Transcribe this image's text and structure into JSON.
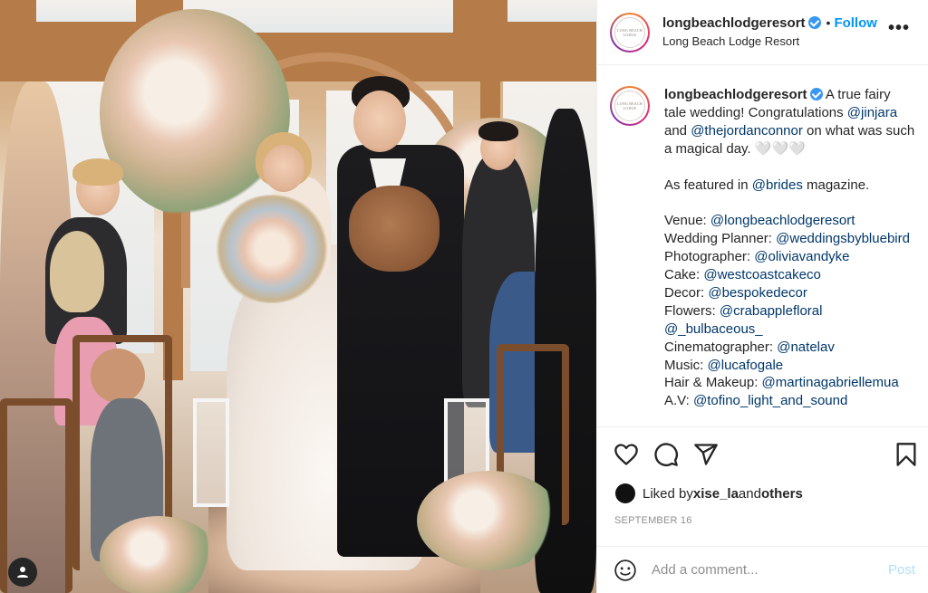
{
  "post": {
    "account": {
      "username": "longbeachlodgeresort",
      "location": "Long Beach Lodge Resort",
      "follow_label": "Follow",
      "separator": "•",
      "avatar_logo_text": "LONG BEACH LODGE"
    },
    "more_label": "•••",
    "caption": {
      "username": "longbeachlodgeresort",
      "lines": [
        {
          "parts": [
            {
              "text": " A true fairy tale wedding! Congratulations "
            },
            {
              "text": "@jinjara",
              "mention": true
            },
            {
              "text": " and "
            },
            {
              "text": "@thejordanconnor",
              "mention": true
            },
            {
              "text": " on what was such a magical day. 🤍🤍🤍"
            }
          ]
        }
      ],
      "featured": {
        "prefix": "As featured in ",
        "mention": "@brides",
        "suffix": " magazine."
      },
      "credits": [
        {
          "label": "Venue: ",
          "handle": "@longbeachlodgeresort"
        },
        {
          "label": "Wedding Planner: ",
          "handle": "@weddingsbybluebird"
        },
        {
          "label": "Photographer: ",
          "handle": "@oliviavandyke"
        },
        {
          "label": "Cake: ",
          "handle": "@westcoastcakeco"
        },
        {
          "label": "Decor: ",
          "handle": "@bespokedecor"
        },
        {
          "label": "Flowers: ",
          "handle": "@crabapplefloral @_bulbaceous_"
        },
        {
          "label": "Cinematographer: ",
          "handle": "@natelav"
        },
        {
          "label": "Music: ",
          "handle": "@lucafogale"
        },
        {
          "label": "Hair & Makeup: ",
          "handle": "@martinagabriellemua"
        },
        {
          "label": "A.V: ",
          "handle": "@tofino_light_and_sound"
        }
      ]
    },
    "likes": {
      "prefix": "Liked by ",
      "user": "xise_la",
      "middle": " and ",
      "others": "others"
    },
    "date": "SEPTEMBER 16",
    "comment_box": {
      "placeholder": "Add a comment...",
      "post_label": "Post"
    },
    "icons": {
      "like": "heart-icon",
      "comment": "comment-bubble-icon",
      "share": "paper-plane-icon",
      "save": "bookmark-icon",
      "emoji": "emoji-icon",
      "tagged_user": "user-tag-icon"
    }
  }
}
